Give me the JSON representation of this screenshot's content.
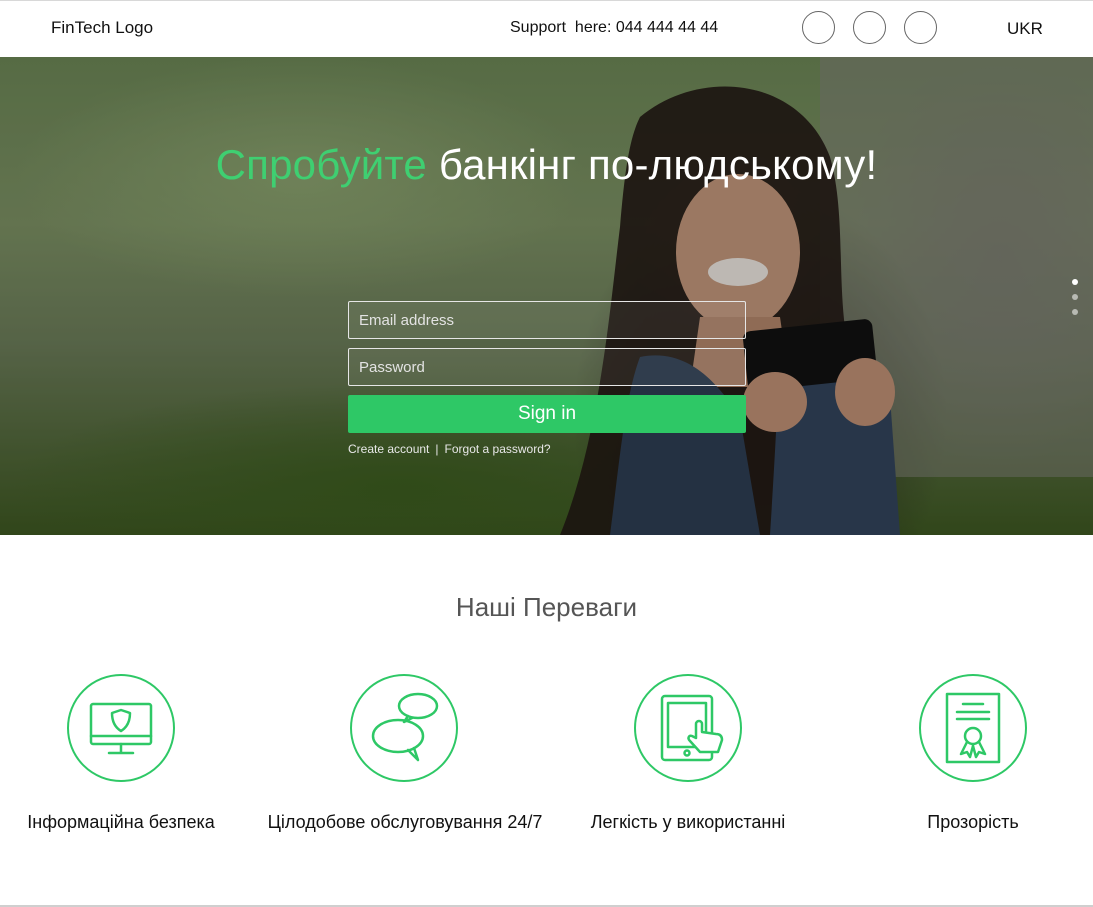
{
  "header": {
    "logo": "FinTech Logo",
    "support": "Support  here: 044 444 44 44",
    "social_count": 3,
    "language": "UKR"
  },
  "hero": {
    "title_accent": "Спробуйте",
    "title_rest": " банкінг по-людському!",
    "email_placeholder": "Email address",
    "password_placeholder": "Password",
    "signin_label": "Sign in",
    "create_account": "Create account",
    "separator": "|",
    "forgot_password": "Forgot a password?",
    "slides": 3,
    "active_slide": 0
  },
  "advantages": {
    "title": "Наші Переваги",
    "items": [
      {
        "icon": "monitor-shield-icon",
        "label": "Інформаційна безпека"
      },
      {
        "icon": "chat-bubbles-icon",
        "label": "Цілодобове обслуговування 24/7"
      },
      {
        "icon": "tablet-touch-icon",
        "label": "Легкість у використанні"
      },
      {
        "icon": "certificate-icon",
        "label": "Прозорість"
      }
    ]
  },
  "colors": {
    "accent": "#2ec866",
    "accent_text": "#3fcf71"
  }
}
